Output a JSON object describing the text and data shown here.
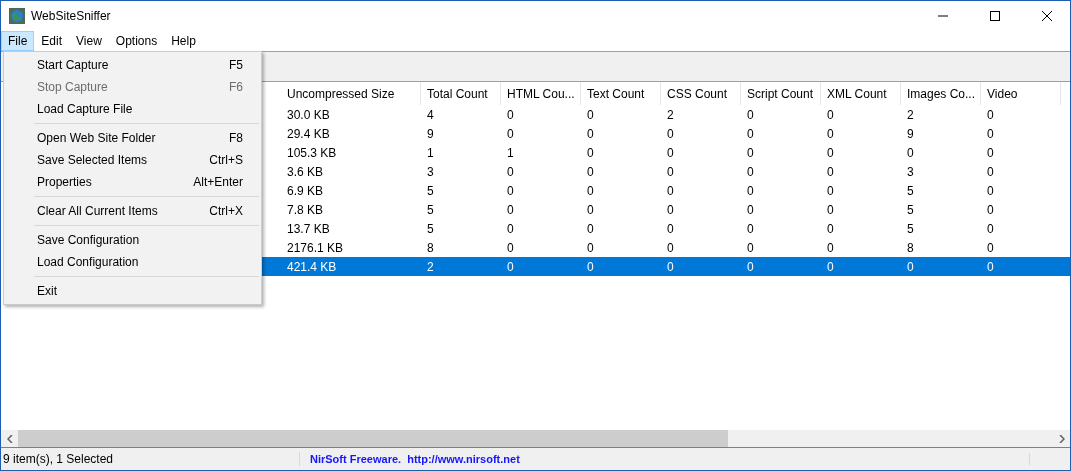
{
  "window": {
    "title": "WebSiteSniffer"
  },
  "menubar": [
    {
      "label": "File",
      "selected": true
    },
    {
      "label": "Edit",
      "selected": false
    },
    {
      "label": "View",
      "selected": false
    },
    {
      "label": "Options",
      "selected": false
    },
    {
      "label": "Help",
      "selected": false
    }
  ],
  "file_menu": [
    {
      "kind": "item",
      "label": "Start Capture",
      "shortcut": "F5",
      "disabled": false
    },
    {
      "kind": "item",
      "label": "Stop Capture",
      "shortcut": "F6",
      "disabled": true
    },
    {
      "kind": "item",
      "label": "Load Capture File",
      "disabled": false
    },
    {
      "kind": "separator"
    },
    {
      "kind": "item",
      "label": "Open Web Site Folder",
      "shortcut": "F8",
      "disabled": false
    },
    {
      "kind": "item",
      "label": "Save Selected Items",
      "shortcut": "Ctrl+S",
      "disabled": false
    },
    {
      "kind": "item",
      "label": "Properties",
      "shortcut": "Alt+Enter",
      "disabled": false
    },
    {
      "kind": "separator"
    },
    {
      "kind": "item",
      "label": "Clear All Current Items",
      "shortcut": "Ctrl+X",
      "disabled": false
    },
    {
      "kind": "separator"
    },
    {
      "kind": "item",
      "label": "Save Configuration",
      "disabled": false
    },
    {
      "kind": "item",
      "label": "Load Configuration",
      "disabled": false
    },
    {
      "kind": "separator"
    },
    {
      "kind": "item",
      "label": "Exit",
      "disabled": false
    }
  ],
  "table": {
    "columns": [
      "Uncompressed Size",
      "Total Count",
      "HTML Cou...",
      "Text Count",
      "CSS Count",
      "Script Count",
      "XML Count",
      "Images Co...",
      "Video"
    ],
    "rows": [
      {
        "cells": [
          "30.0 KB",
          "4",
          "0",
          "0",
          "2",
          "0",
          "0",
          "2",
          "0"
        ],
        "selected": false
      },
      {
        "cells": [
          "29.4 KB",
          "9",
          "0",
          "0",
          "0",
          "0",
          "0",
          "9",
          "0"
        ],
        "selected": false
      },
      {
        "cells": [
          "105.3 KB",
          "1",
          "1",
          "0",
          "0",
          "0",
          "0",
          "0",
          "0"
        ],
        "selected": false
      },
      {
        "cells": [
          "3.6 KB",
          "3",
          "0",
          "0",
          "0",
          "0",
          "0",
          "3",
          "0"
        ],
        "selected": false
      },
      {
        "cells": [
          "6.9 KB",
          "5",
          "0",
          "0",
          "0",
          "0",
          "0",
          "5",
          "0"
        ],
        "selected": false
      },
      {
        "cells": [
          "7.8 KB",
          "5",
          "0",
          "0",
          "0",
          "0",
          "0",
          "5",
          "0"
        ],
        "selected": false
      },
      {
        "cells": [
          "13.7 KB",
          "5",
          "0",
          "0",
          "0",
          "0",
          "0",
          "5",
          "0"
        ],
        "selected": false
      },
      {
        "cells": [
          "2176.1 KB",
          "8",
          "0",
          "0",
          "0",
          "0",
          "0",
          "8",
          "0"
        ],
        "selected": false
      },
      {
        "cells": [
          "421.4 KB",
          "2",
          "0",
          "0",
          "0",
          "0",
          "0",
          "0",
          "0"
        ],
        "selected": true
      }
    ]
  },
  "status_bar": {
    "items": "9 item(s), 1 Selected",
    "link": "NirSoft Freeware.  http://www.nirsoft.net"
  }
}
